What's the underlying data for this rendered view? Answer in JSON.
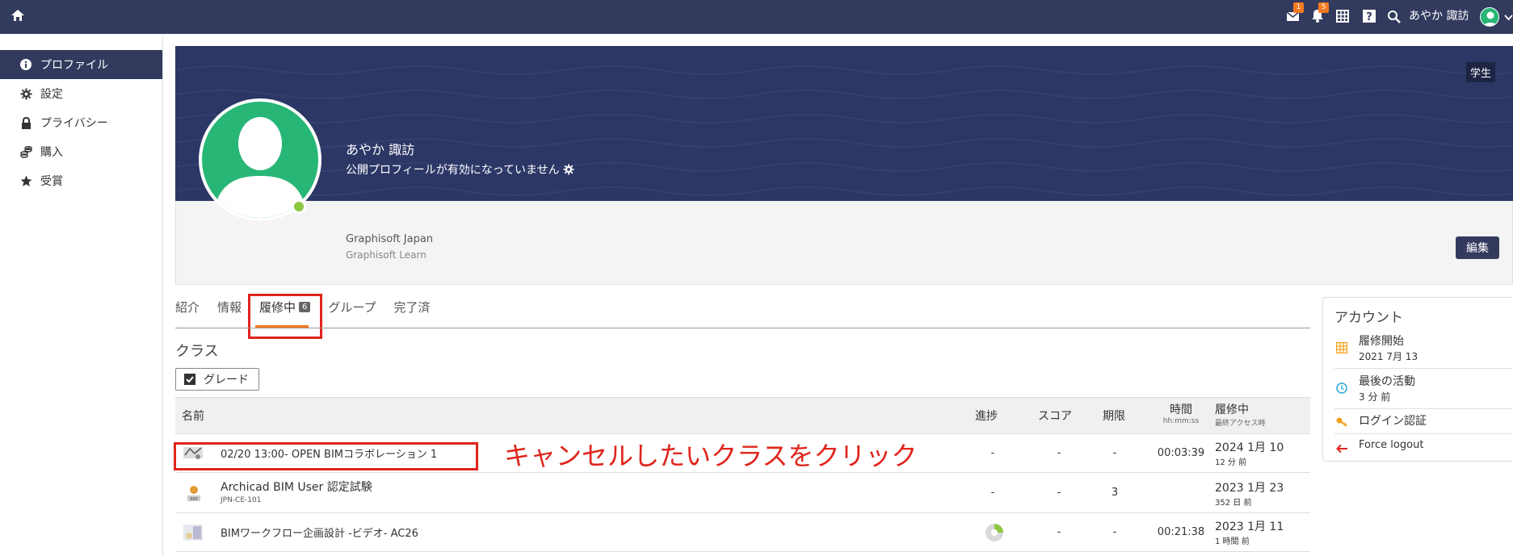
{
  "topbar": {
    "home_icon": "home-icon",
    "mail_badge": "1",
    "bell_badge": "5",
    "user_name": "あやか 諏訪"
  },
  "sidebar": {
    "items": [
      {
        "label": "プロファイル",
        "icon": "info-icon"
      },
      {
        "label": "設定",
        "icon": "gear-icon"
      },
      {
        "label": "プライバシー",
        "icon": "lock-icon"
      },
      {
        "label": "購入",
        "icon": "coins-icon"
      },
      {
        "label": "受賞",
        "icon": "star-icon"
      }
    ]
  },
  "profile": {
    "role_badge": "学生",
    "name": "あやか 諏訪",
    "public_status": "公開プロフィールが有効になっていません",
    "org": "Graphisoft Japan",
    "org_sub": "Graphisoft Learn",
    "edit_label": "編集"
  },
  "tabs": [
    {
      "label": "紹介"
    },
    {
      "label": "情報"
    },
    {
      "label": "履修中",
      "count": "6"
    },
    {
      "label": "グループ"
    },
    {
      "label": "完了済"
    }
  ],
  "section_title": "クラス",
  "grade_button": "グレード",
  "table": {
    "headers": {
      "name": "名前",
      "progress": "進捗",
      "score": "スコア",
      "deadline": "期限",
      "time": "時間",
      "time_sub": "hh:mm:ss",
      "status": "履修中",
      "status_sub": "最終アクセス時"
    },
    "rows": [
      {
        "title": "02/20 13:00- OPEN BIMコラボレーション 1",
        "code": "",
        "progress": "-",
        "score": "-",
        "deadline": "-",
        "time": "00:03:39",
        "date": "2024 1月 10",
        "ago": "12 分 前"
      },
      {
        "title": "Archicad BIM User 認定試験",
        "code": "JPN-CE-101",
        "progress": "-",
        "score": "-",
        "deadline": "3",
        "time": "",
        "date": "2023 1月 23",
        "ago": "352 日 前"
      },
      {
        "title": "BIMワークフロー企画設計 -ビデオ- AC26",
        "code": "",
        "progress": "",
        "score": "-",
        "deadline": "-",
        "time": "00:21:38",
        "date": "2023 1月 11",
        "ago": "1 時間 前"
      }
    ]
  },
  "annotation": "キャンセルしたいクラスをクリック",
  "account": {
    "title": "アカウント",
    "items": [
      {
        "label": "履修開始",
        "value": "2021 7月 13"
      },
      {
        "label": "最後の活動",
        "value": "3 分 前"
      },
      {
        "label": "ログイン認証",
        "value": ""
      },
      {
        "label": "Force logout",
        "value": ""
      }
    ]
  },
  "colors": {
    "nav": "#323a5e",
    "avatar_bg": "#27b676",
    "accent_orange": "#f47a20",
    "annotation_red": "#e0241b"
  }
}
